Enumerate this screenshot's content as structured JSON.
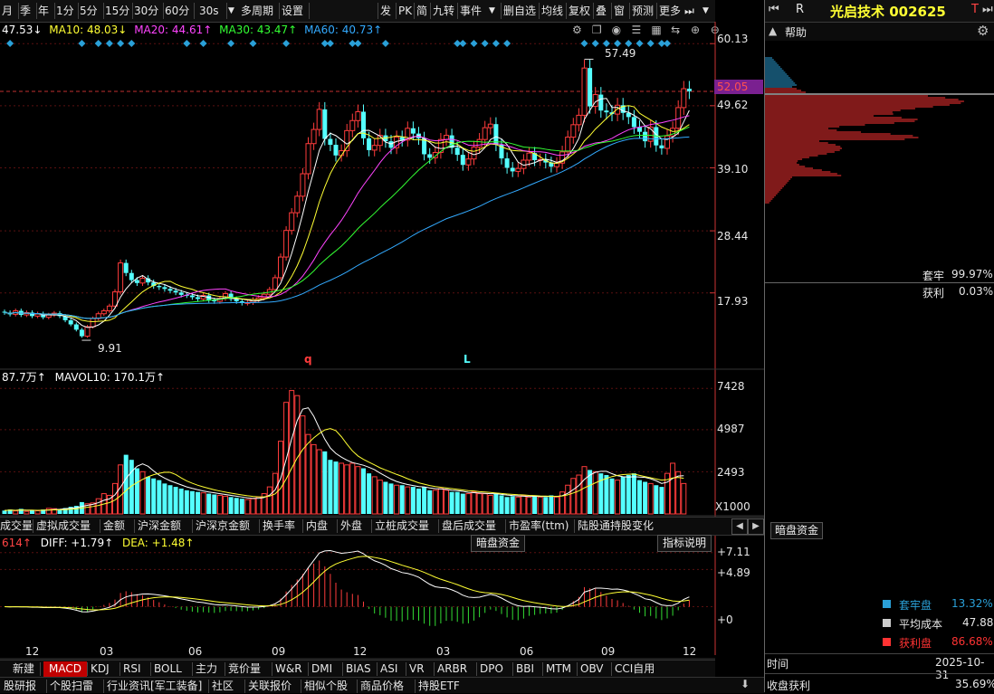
{
  "toolbar": {
    "left_items": [
      "月",
      "季",
      "年",
      "1分",
      "5分",
      "15分",
      "30分",
      "60分",
      "30s",
      "多周期",
      "设置"
    ],
    "dropdown_arrow": "▼",
    "right_items": [
      "发",
      "PK",
      "简",
      "九转",
      "事件",
      "删自选",
      "均线",
      "复权",
      "叠",
      "窗",
      "预测",
      "更多"
    ]
  },
  "ma_legend": {
    "ma5": "47.53↓",
    "ma10": "MA10: 48.03↓",
    "ma20": "MA20: 44.61↑",
    "ma30": "MA30: 43.47↑",
    "ma60": "MA60: 40.73↑"
  },
  "price_axis": {
    "labels": [
      "60.13",
      "49.62",
      "39.10",
      "28.44",
      "17.93"
    ],
    "current": "52.05",
    "high_note": "57.49",
    "low_note": "9.91"
  },
  "markers": {
    "q": "q",
    "l": "L"
  },
  "volume": {
    "legend_a": "87.7万↑",
    "legend_b": "MAVOL10: 170.1万↑",
    "axis": [
      "7428",
      "4987",
      "2493"
    ],
    "unit": "X1000"
  },
  "indicator_tabs": [
    "成交量",
    "虚拟成交量",
    "金额",
    "沪深金额",
    "沪深京金额",
    "换手率",
    "内盘",
    "外盘",
    "立桩成交量",
    "盘后成交量",
    "市盈率(ttm)",
    "陆股通持股变化"
  ],
  "macd": {
    "macd_val": "614↑",
    "diff": "DIFF: +1.79↑",
    "dea": "DEA: +1.48↑",
    "btn_dark": "暗盘资金",
    "btn_help": "指标说明",
    "axis": [
      "+7.11",
      "+4.89",
      "+0"
    ]
  },
  "months": [
    "12",
    "03",
    "06",
    "09",
    "12",
    "03",
    "06",
    "09",
    "12"
  ],
  "bottom_tabs": [
    "新建",
    "MACD",
    "KDJ",
    "RSI",
    "BOLL",
    "主力",
    "竞价量",
    "W&R",
    "DMI",
    "BIAS",
    "ASI",
    "VR",
    "ARBR",
    "DPO",
    "BBI",
    "MTM",
    "OBV",
    "CCI自用"
  ],
  "news_tabs": [
    "股研报",
    "个股扫雷",
    "行业资讯[军工装备]",
    "社区",
    "关联报价",
    "相似个股",
    "商品价格",
    "持股ETF"
  ],
  "right_panel": {
    "nav": "R",
    "stock_title": "光启技术 002625",
    "help": "帮助",
    "trapped_label": "套牢",
    "trapped_val": "99.97%",
    "profit_label": "获利",
    "profit_val": "0.03%",
    "dark_btn": "暗盘资金",
    "legend": [
      {
        "label": "套牢盘",
        "value": "13.32%",
        "color": "#2aa0d8"
      },
      {
        "label": "平均成本",
        "value": "47.88",
        "color": "#cccccc"
      },
      {
        "label": "获利盘",
        "value": "86.68%",
        "color": "#ff3333"
      }
    ],
    "time_label": "时间",
    "time_val": "2025-10-31",
    "close_label": "收盘获利",
    "close_val": "35.69%"
  },
  "colors": {
    "up": "#ff3c3c",
    "down": "#54ffff",
    "ma5": "#ffffff",
    "ma10": "#ffff33",
    "ma20": "#ff44ff",
    "ma30": "#33ff33",
    "ma60": "#33aaff"
  },
  "chart_data": {
    "type": "candlestick",
    "ylim": [
      9,
      62
    ],
    "closes": [
      14.6,
      14.3,
      14.9,
      14.2,
      14.6,
      14.0,
      14.4,
      13.8,
      14.2,
      14.5,
      14.0,
      13.3,
      12.6,
      11.7,
      10.6,
      12.2,
      13.6,
      14.4,
      14.9,
      15.7,
      18.1,
      23.0,
      21.3,
      20.1,
      19.6,
      20.4,
      19.7,
      19.1,
      18.9,
      18.6,
      18.3,
      18.0,
      17.6,
      17.5,
      17.2,
      16.9,
      17.5,
      16.7,
      16.5,
      17.0,
      17.8,
      16.9,
      16.5,
      16.2,
      16.3,
      16.8,
      17.1,
      17.7,
      18.5,
      20.5,
      24.0,
      28.5,
      31.5,
      34.3,
      38.1,
      43.2,
      45.6,
      49.0,
      44.0,
      43.0,
      41.2,
      42.0,
      45.4,
      47.1,
      48.6,
      44.1,
      42.1,
      42.9,
      44.6,
      43.6,
      42.5,
      44.3,
      43.8,
      45.8,
      44.9,
      44.1,
      41.4,
      40.8,
      41.7,
      43.9,
      44.6,
      42.5,
      41.3,
      39.6,
      40.6,
      42.6,
      43.9,
      45.9,
      46.5,
      43.0,
      40.7,
      39.1,
      38.5,
      39.0,
      40.4,
      41.6,
      40.4,
      40.5,
      40.0,
      39.3,
      39.9,
      41.8,
      44.3,
      46.4,
      48.0,
      56.0,
      49.5,
      51.5,
      48.8,
      48.5,
      48.2,
      49.7,
      48.4,
      47.7,
      46.0,
      45.2,
      43.6,
      46.0,
      42.9,
      42.4,
      44.5,
      45.8,
      49.3,
      52.5,
      52.05
    ],
    "volume_k": [
      200,
      260,
      180,
      300,
      150,
      220,
      190,
      260,
      330,
      310,
      280,
      350,
      420,
      480,
      700,
      600,
      650,
      900,
      1200,
      1100,
      1800,
      2900,
      3500,
      3200,
      2700,
      2500,
      2200,
      2100,
      2000,
      1800,
      1700,
      1600,
      1500,
      1400,
      1350,
      1300,
      1250,
      1200,
      1150,
      1100,
      1050,
      1000,
      950,
      900,
      850,
      900,
      1000,
      1200,
      1600,
      2400,
      4300,
      6600,
      7300,
      7000,
      5800,
      4700,
      4100,
      3800,
      3700,
      3200,
      3100,
      3000,
      2900,
      3000,
      2800,
      2700,
      2400,
      2200,
      2000,
      1900,
      1800,
      1700,
      1700,
      1600,
      1600,
      1500,
      1600,
      1400,
      1400,
      1500,
      1400,
      1300,
      1300,
      1200,
      1200,
      1300,
      1200,
      1200,
      1100,
      1200,
      1100,
      1000,
      1050,
      1000,
      1100,
      1000,
      1100,
      1000,
      1000,
      1100,
      1000,
      1300,
      1700,
      2100,
      2300,
      2800,
      2600,
      2500,
      2400,
      2300,
      2100,
      2000,
      2200,
      2300,
      2400,
      2000,
      1900,
      1800,
      1700,
      1600,
      2400,
      3000,
      2500,
      1800
    ]
  }
}
